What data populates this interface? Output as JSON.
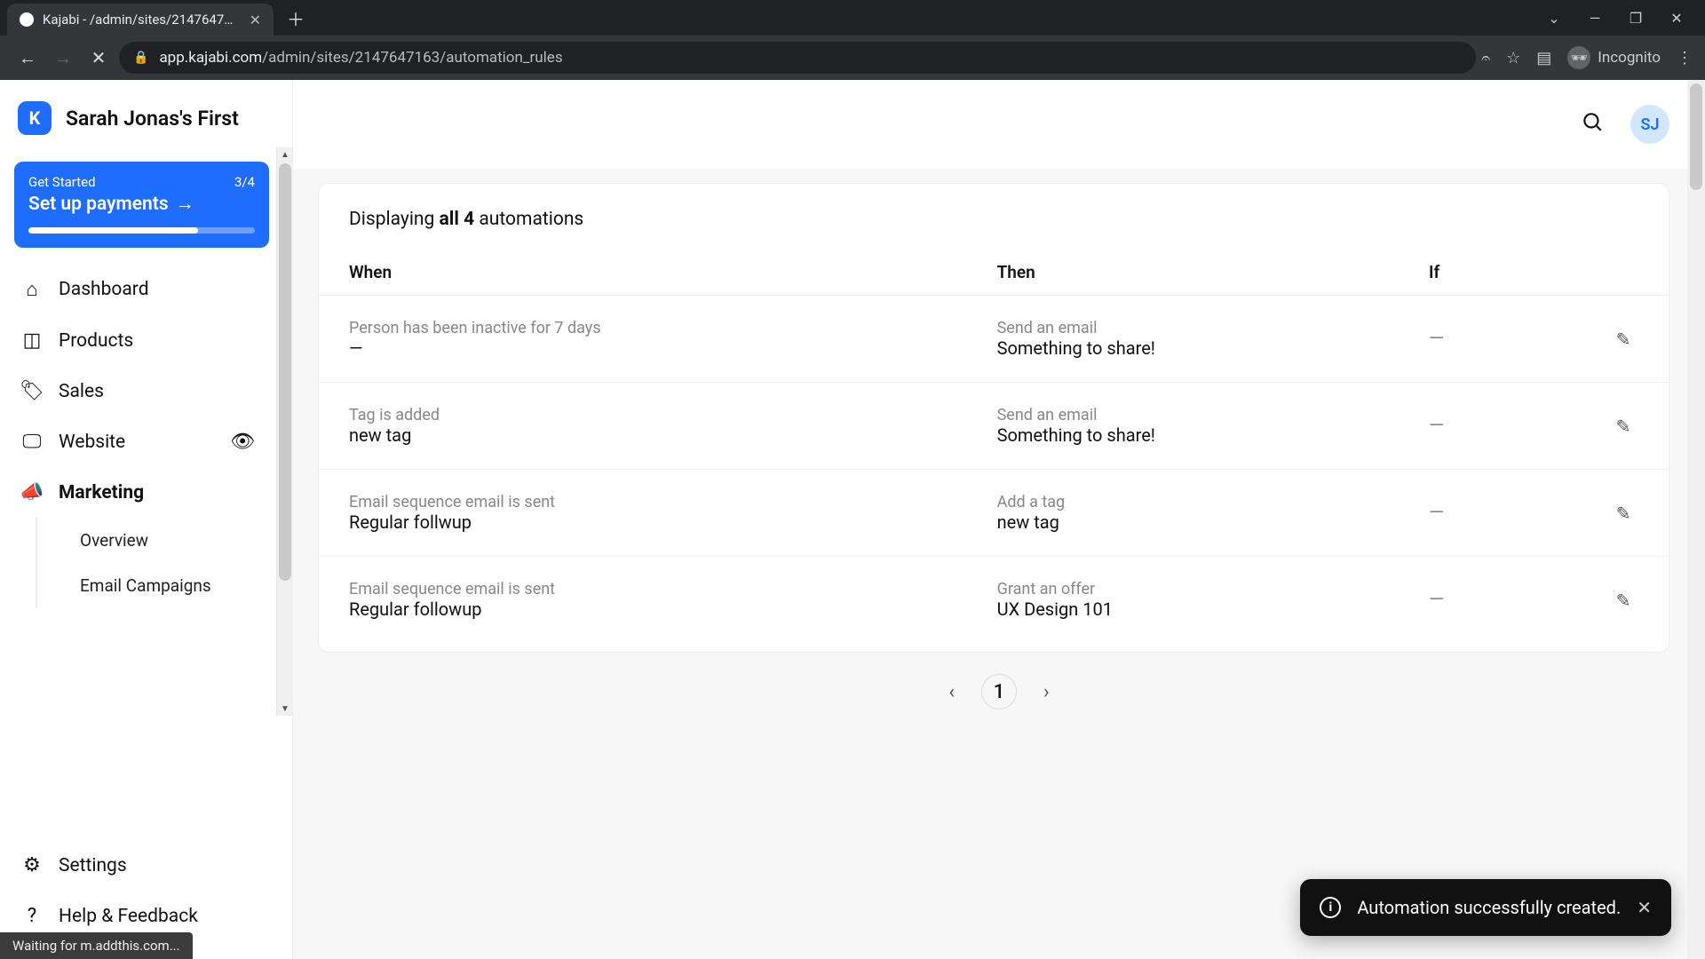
{
  "browser": {
    "tab_title": "Kajabi - /admin/sites/2147647163",
    "url_host": "app.kajabi.com",
    "url_path": "/admin/sites/2147647163/automation_rules",
    "incognito_label": "Incognito",
    "status_text": "Waiting for m.addthis.com..."
  },
  "header": {
    "site_name": "Sarah Jonas's First",
    "avatar_initials": "SJ"
  },
  "get_started": {
    "label": "Get Started",
    "progress_text": "3/4",
    "cta": "Set up payments"
  },
  "sidebar": {
    "items": [
      {
        "label": "Dashboard"
      },
      {
        "label": "Products"
      },
      {
        "label": "Sales"
      },
      {
        "label": "Website"
      },
      {
        "label": "Marketing"
      }
    ],
    "marketing_sub": [
      {
        "label": "Overview"
      },
      {
        "label": "Email Campaigns"
      }
    ],
    "footer": [
      {
        "label": "Settings"
      },
      {
        "label": "Help & Feedback"
      }
    ]
  },
  "main": {
    "display_prefix": "Displaying ",
    "display_bold": "all 4",
    "display_suffix": " automations",
    "columns": {
      "when": "When",
      "then": "Then",
      "if": "If"
    },
    "rows": [
      {
        "when_light": "Person has been inactive for 7 days",
        "when_value": "—",
        "then_light": "Send an email",
        "then_value": "Something to share!",
        "if": "—"
      },
      {
        "when_light": "Tag is added",
        "when_value": "new tag",
        "then_light": "Send an email",
        "then_value": "Something to share!",
        "if": "—"
      },
      {
        "when_light": "Email sequence email is sent",
        "when_value": "Regular follwup",
        "then_light": "Add a tag",
        "then_value": "new tag",
        "if": "—"
      },
      {
        "when_light": "Email sequence email is sent",
        "when_value": "Regular followup",
        "then_light": "Grant an offer",
        "then_value": "UX Design 101",
        "if": "—"
      }
    ],
    "pager": {
      "current": "1"
    }
  },
  "toast": {
    "message": "Automation successfully created."
  }
}
